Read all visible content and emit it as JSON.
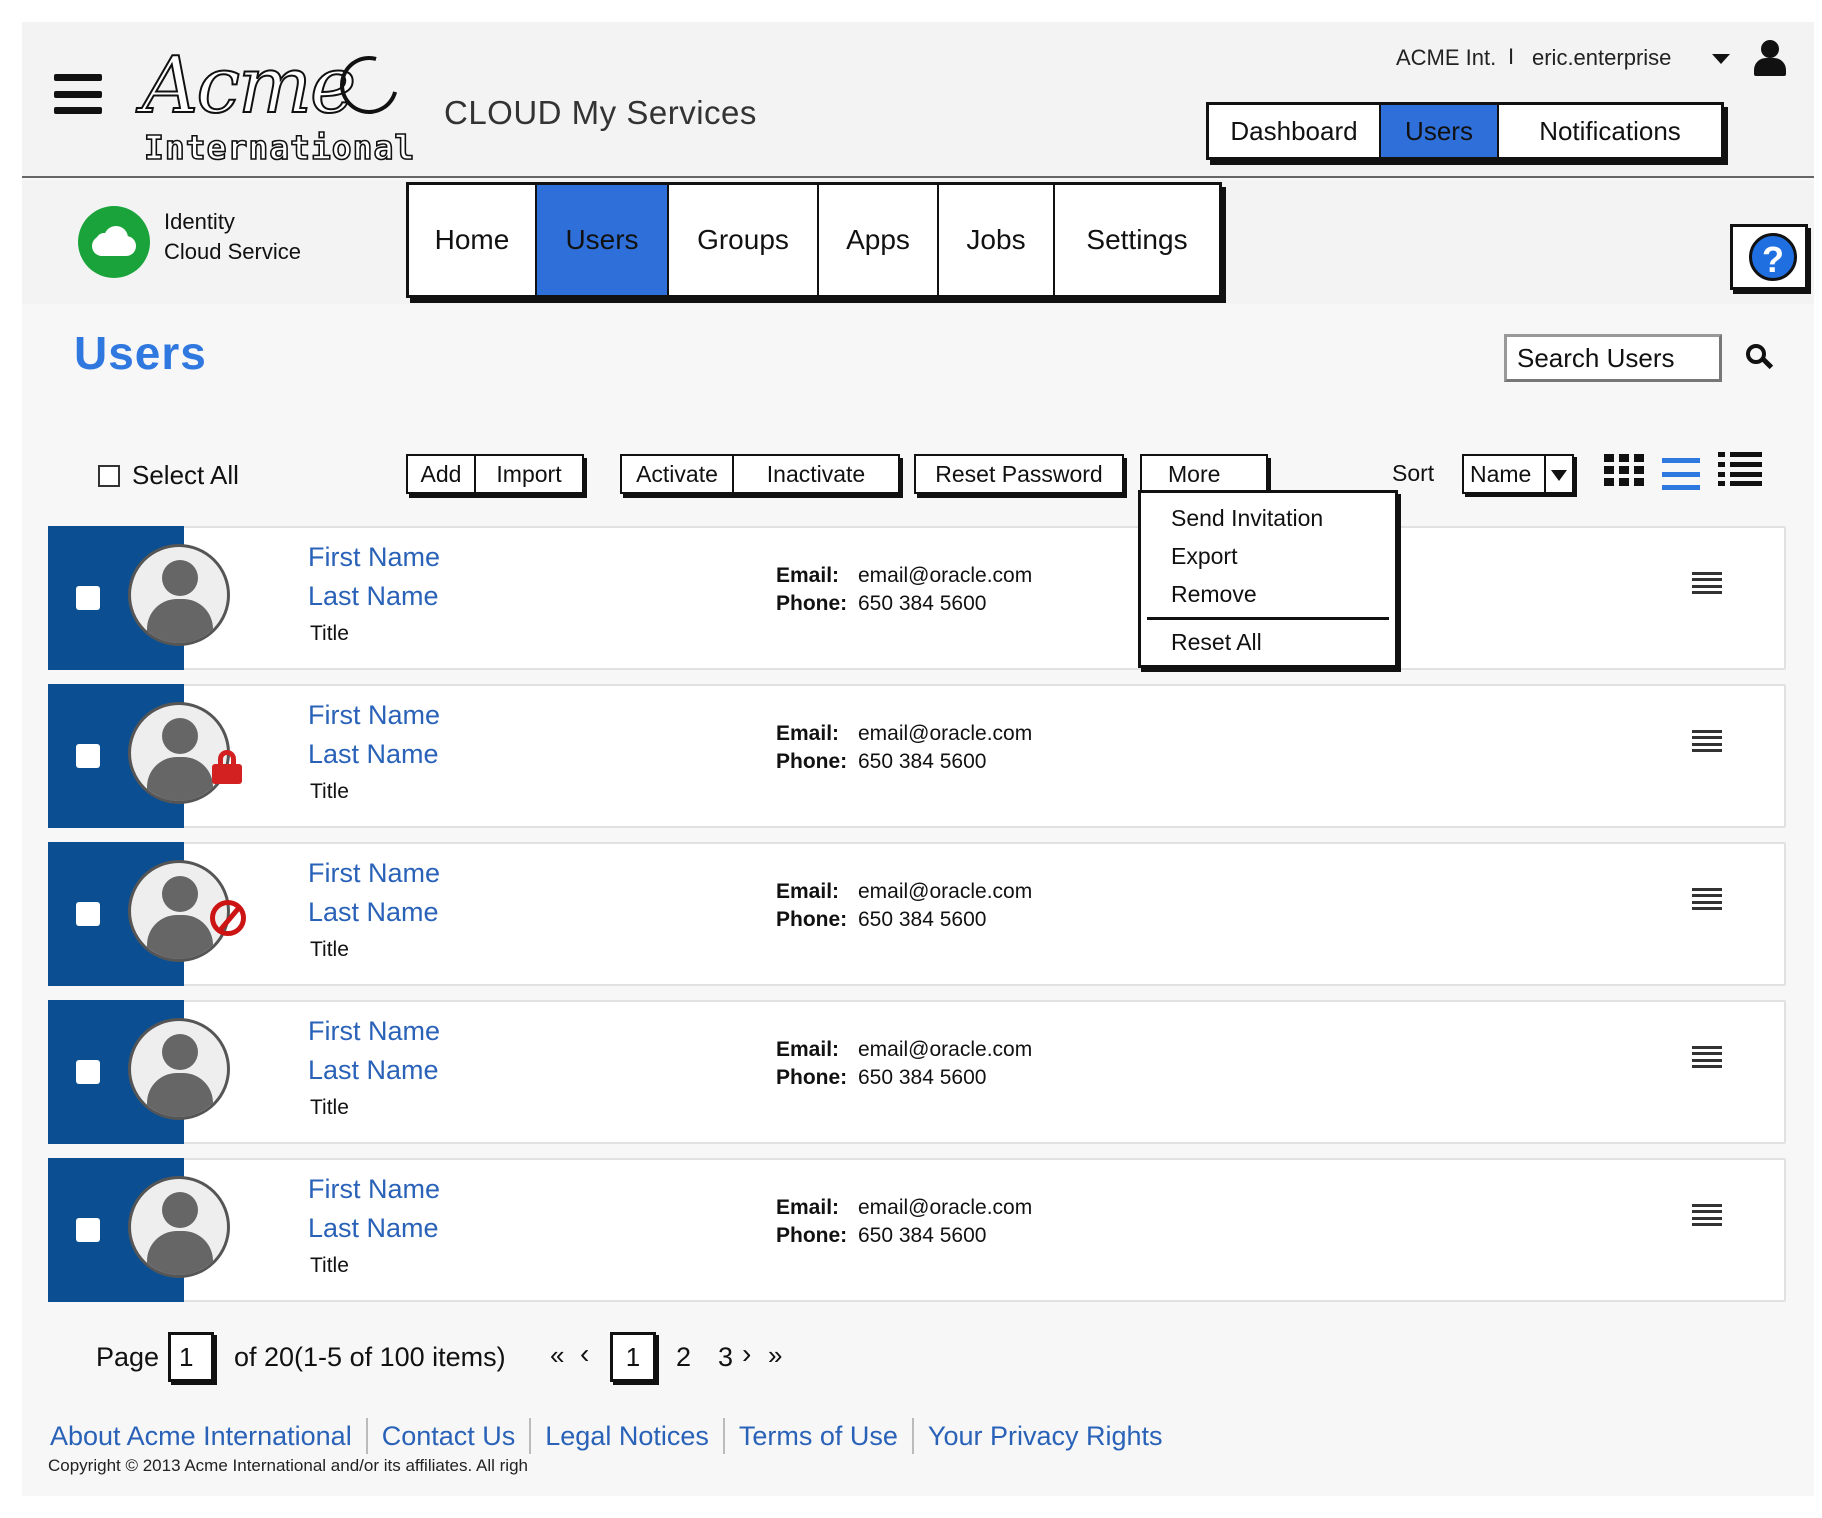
{
  "header": {
    "logo_script": "Acme",
    "logo_sub": "International",
    "app_title": "CLOUD My Services",
    "org_name": "ACME Int.",
    "separator": "I",
    "username": "eric.enterprise",
    "tabs": [
      {
        "label": "Dashboard",
        "active": false
      },
      {
        "label": "Users",
        "active": true
      },
      {
        "label": "Notifications",
        "active": false
      }
    ]
  },
  "service": {
    "name_line1": "Identity",
    "name_line2": "Cloud Service",
    "nav": [
      {
        "label": "Home",
        "active": false
      },
      {
        "label": "Users",
        "active": true
      },
      {
        "label": "Groups",
        "active": false
      },
      {
        "label": "Apps",
        "active": false
      },
      {
        "label": "Jobs",
        "active": false
      },
      {
        "label": "Settings",
        "active": false
      }
    ],
    "help_glyph": "?"
  },
  "page": {
    "title": "Users",
    "search_placeholder": "Search Users"
  },
  "toolbar": {
    "select_all": "Select All",
    "add": "Add",
    "import": "Import",
    "activate": "Activate",
    "inactivate": "Inactivate",
    "reset_password": "Reset Password",
    "more": "More",
    "sort_label": "Sort",
    "sort_value": "Name"
  },
  "more_menu": {
    "items": [
      "Send Invitation",
      "Export",
      "Remove"
    ],
    "reset": "Reset All"
  },
  "users": [
    {
      "first": "First Name",
      "last": "Last Name",
      "title": "Title",
      "email_label": "Email:",
      "email": "email@oracle.com",
      "phone_label": "Phone:",
      "phone": "650 384 5600",
      "status": "active"
    },
    {
      "first": "First Name",
      "last": "Last Name",
      "title": "Title",
      "email_label": "Email:",
      "email": "email@oracle.com",
      "phone_label": "Phone:",
      "phone": "650 384 5600",
      "status": "locked"
    },
    {
      "first": "First Name",
      "last": "Last Name",
      "title": "Title",
      "email_label": "Email:",
      "email": "email@oracle.com",
      "phone_label": "Phone:",
      "phone": "650 384 5600",
      "status": "blocked"
    },
    {
      "first": "First Name",
      "last": "Last Name",
      "title": "Title",
      "email_label": "Email:",
      "email": "email@oracle.com",
      "phone_label": "Phone:",
      "phone": "650 384 5600",
      "status": "active"
    },
    {
      "first": "First Name",
      "last": "Last Name",
      "title": "Title",
      "email_label": "Email:",
      "email": "email@oracle.com",
      "phone_label": "Phone:",
      "phone": "650 384 5600",
      "status": "active"
    }
  ],
  "pagination": {
    "page_label": "Page",
    "page_value": "1",
    "of_text": "of 20(1-5 of 100 items)",
    "first": "«",
    "prev": "‹",
    "current": "1",
    "page2": "2",
    "page3": "3",
    "next": "›",
    "last": "»"
  },
  "footer": {
    "links": [
      "About Acme International",
      "Contact Us",
      "Legal Notices",
      "Terms of Use",
      "Your Privacy Rights"
    ],
    "copyright": "Copyright © 2013 Acme International and/or its affiliates. All righ"
  },
  "colors": {
    "accent_blue": "#2f6fd9",
    "row_stripe": "#0b4f92",
    "link_blue": "#2a62b8",
    "badge_green": "#1aa33a",
    "lock_red": "#d32020"
  }
}
